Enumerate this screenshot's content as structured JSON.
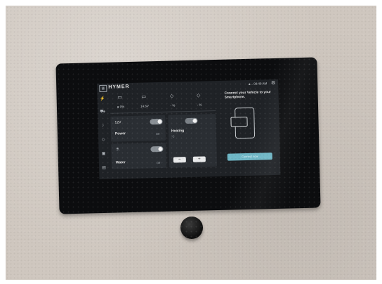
{
  "header": {
    "logo_glyph": "▦",
    "brand": "HYMER",
    "status_time": "▲.. 09:49 AM",
    "gear_glyph": "⚙"
  },
  "sidebar": {
    "items": [
      {
        "name": "power-icon",
        "glyph": "⚡"
      },
      {
        "name": "vehicle-icon",
        "glyph": "⛟"
      },
      {
        "name": "light-icon",
        "glyph": "♪"
      },
      {
        "name": "water-drop-icon",
        "glyph": "◇"
      },
      {
        "name": "box-icon",
        "glyph": "▣"
      },
      {
        "name": "van-icon",
        "glyph": "▤"
      }
    ]
  },
  "top_readings": [
    {
      "icon_name": "battery-icon",
      "icon": "▭",
      "value": "● 0%"
    },
    {
      "icon_name": "vehicle-battery-icon",
      "icon": "▭",
      "value": "14.6V"
    },
    {
      "icon_name": "fresh-water-icon",
      "icon": "◇",
      "value": "- %"
    },
    {
      "icon_name": "grey-water-icon",
      "icon": "◇",
      "value": "- %"
    }
  ],
  "tiles": {
    "power": {
      "label": "Power",
      "voltage": "12V",
      "state": "Off"
    },
    "water": {
      "label": "Water",
      "glyph": "⚗",
      "state": "Off"
    },
    "heating": {
      "label": "Heating",
      "unit": "°C",
      "minus": "−",
      "plus": "+"
    }
  },
  "connect_panel": {
    "title": "Connect your Vehicle to your Smartphone.",
    "button": "Connect now"
  }
}
